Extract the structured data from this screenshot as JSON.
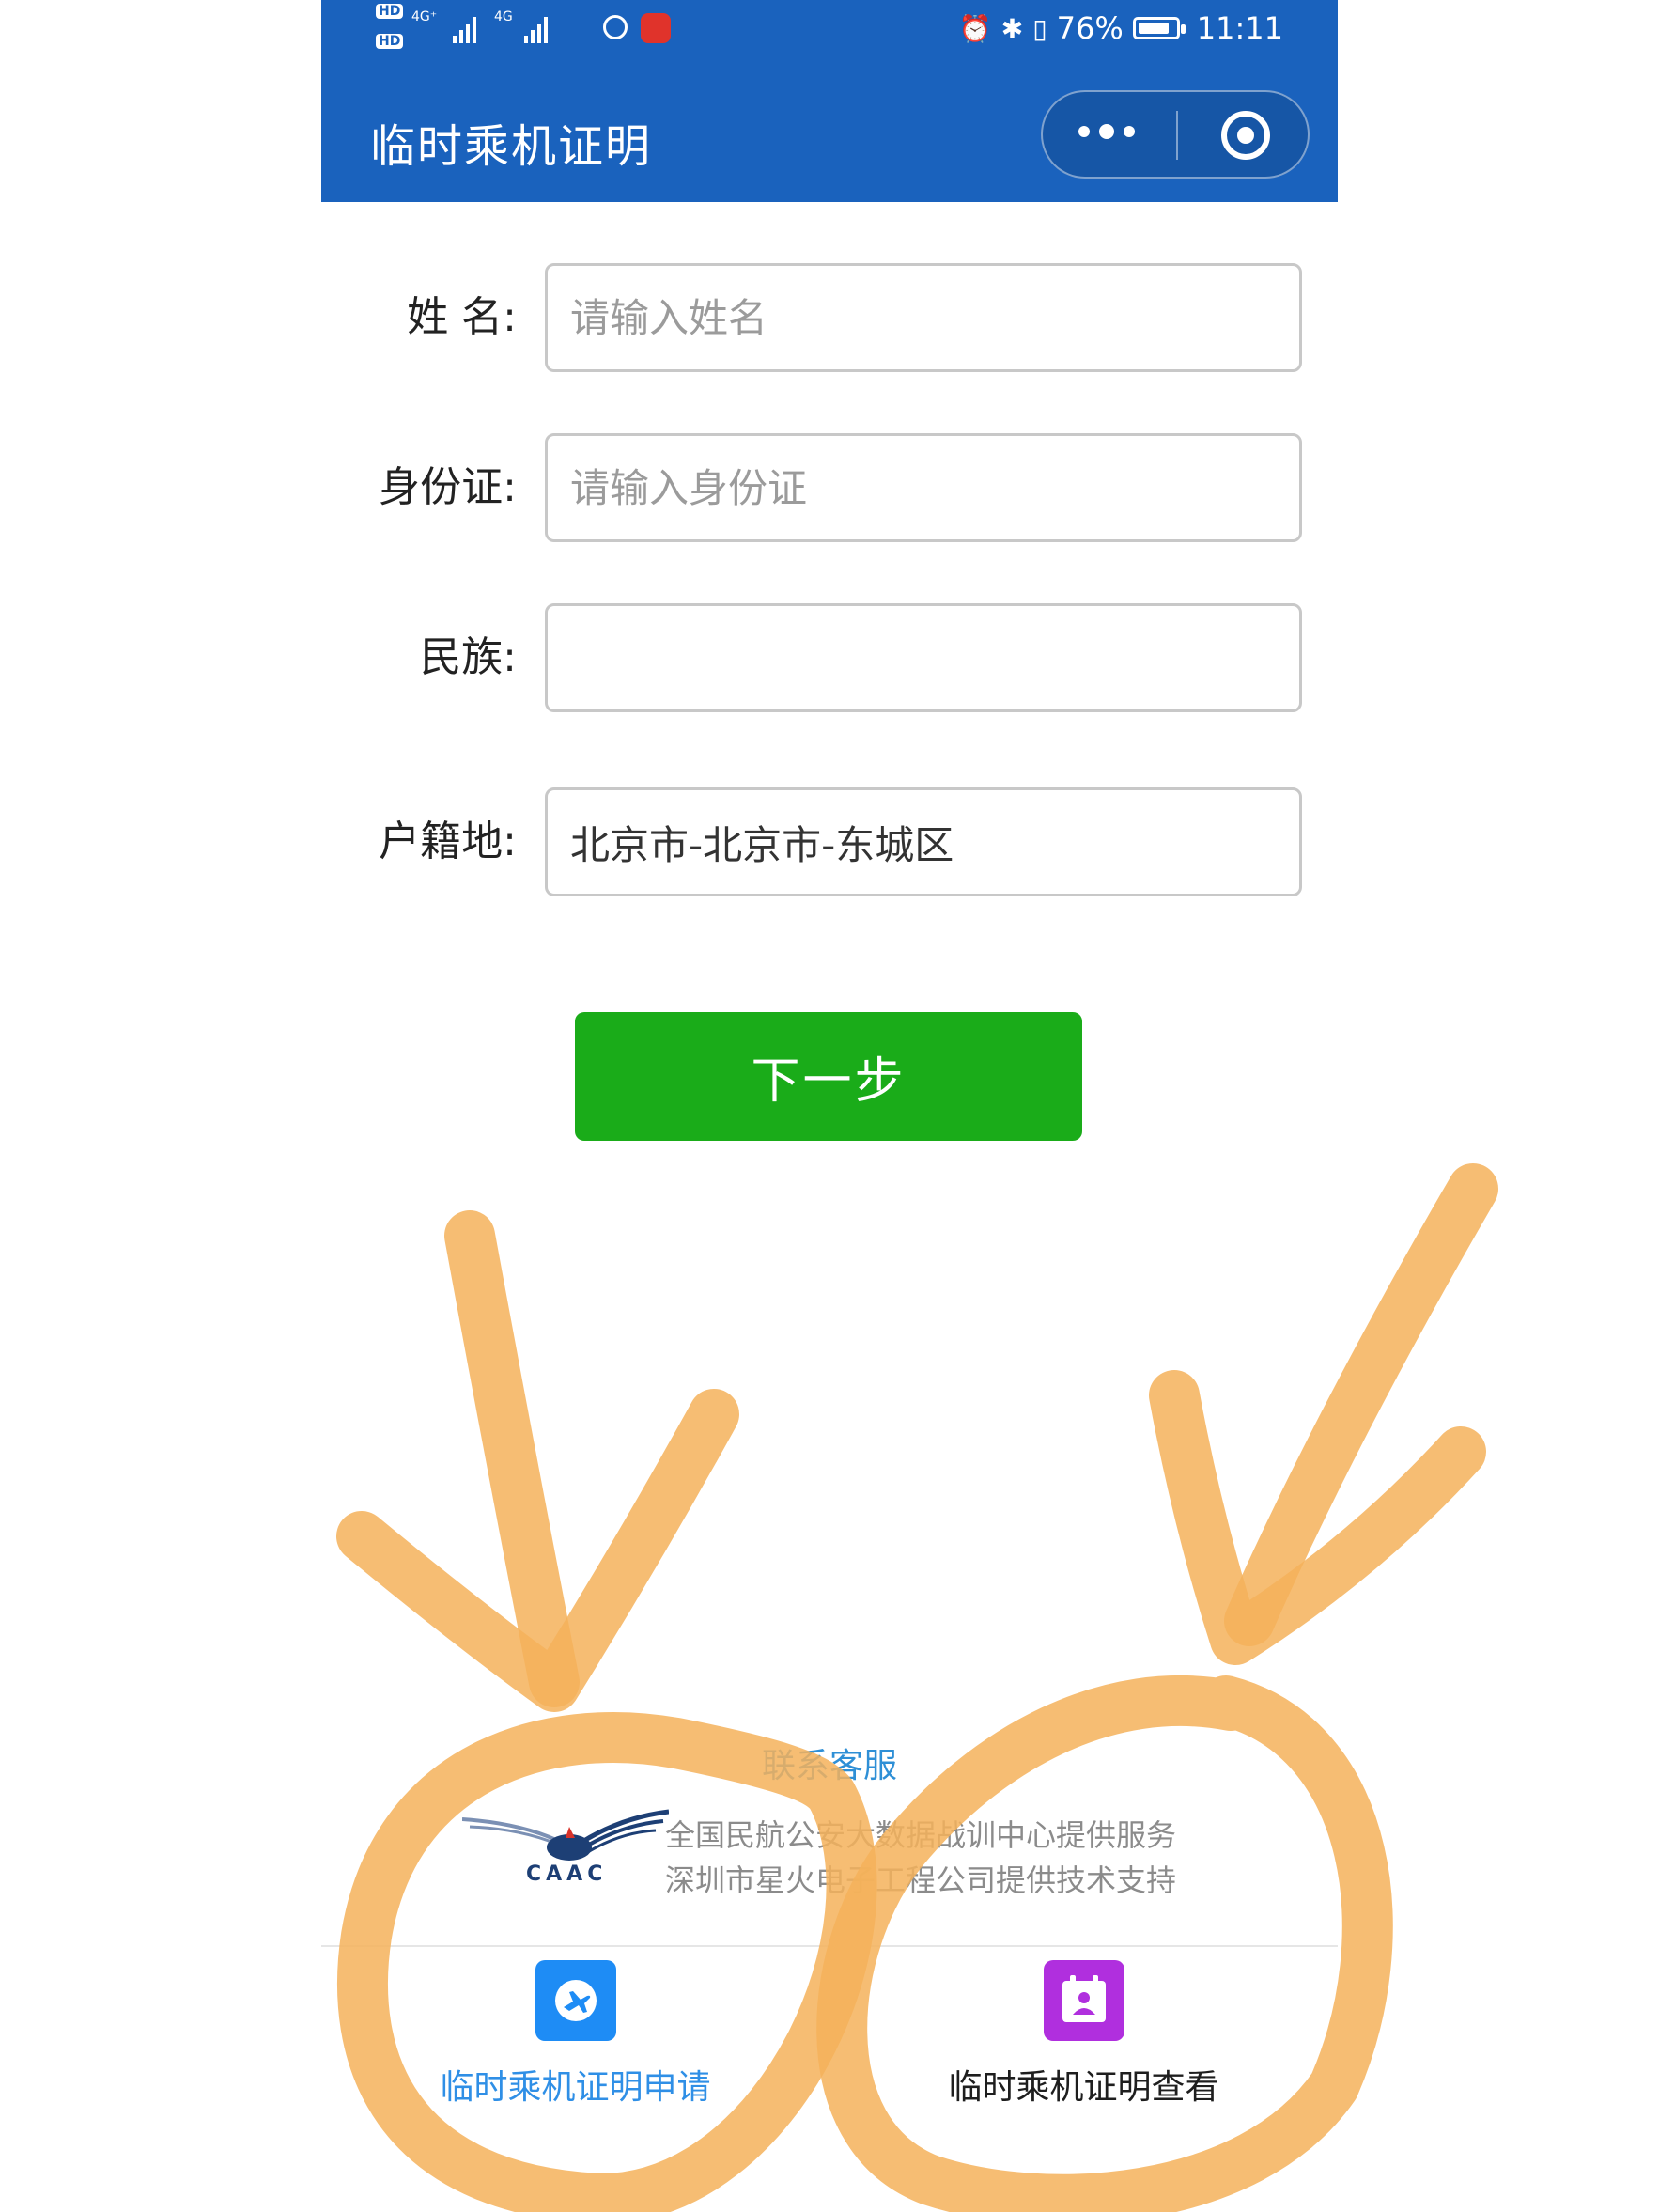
{
  "status_bar": {
    "network_left": "4G⁺",
    "network_right": "4G",
    "hd_labels": [
      "HD",
      "HD"
    ],
    "battery": "76%",
    "time": "11:11"
  },
  "nav": {
    "title": "临时乘机证明"
  },
  "form": {
    "name_label": "姓 名:",
    "name_placeholder": "请输入姓名",
    "id_label": "身份证:",
    "id_placeholder": "请输入身份证",
    "ethnicity_label": "民族:",
    "ethnicity_value": "",
    "residence_label": "户籍地:",
    "residence_value": "北京市-北京市-东城区"
  },
  "next_button": "下一步",
  "footer": {
    "contact": "联系客服",
    "logo_text": "CAAC",
    "line1": "全国民航公安大数据战训中心提供服务",
    "line2": "深圳市星火电子工程公司提供技术支持"
  },
  "tabs": [
    {
      "label": "临时乘机证明申请",
      "active": true,
      "color": "#2f8fe6"
    },
    {
      "label": "临时乘机证明查看",
      "active": false,
      "color": "#1e1e1e"
    }
  ],
  "colors": {
    "header": "#1a62bd",
    "button": "#1aac19",
    "annotation": "#f5b25a",
    "tab_icon_apply": "#1e8cf5",
    "tab_icon_view": "#b02fde"
  },
  "icons": [
    "alarm-icon",
    "bluetooth-icon",
    "vibrate-icon",
    "battery-icon",
    "more-icon",
    "target-icon",
    "caac-logo-icon",
    "plane-icon",
    "certificate-icon"
  ]
}
